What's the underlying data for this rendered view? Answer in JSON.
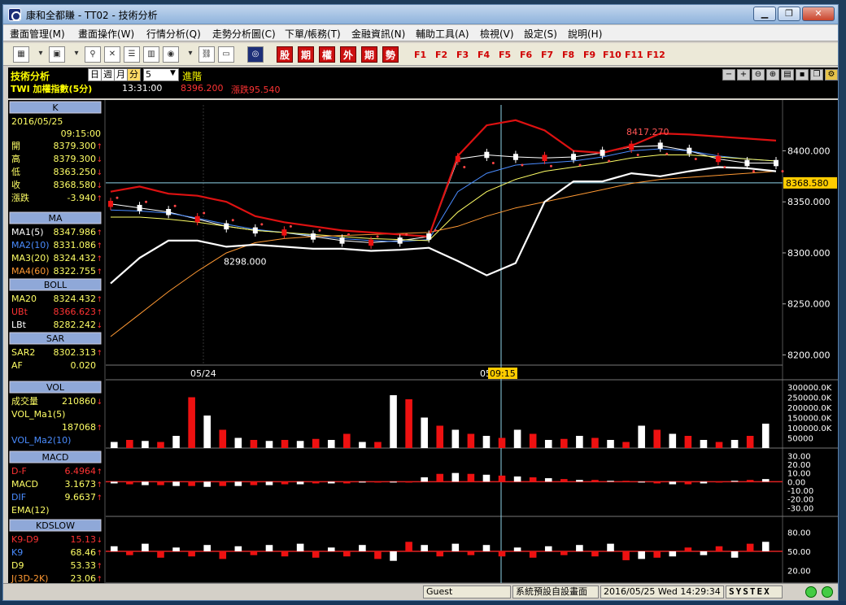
{
  "window": {
    "title": "康和全都賺 - TT02 - 技術分析"
  },
  "menu": [
    "畫面管理(M)",
    "畫面操作(W)",
    "行情分析(Q)",
    "走勢分析圖(C)",
    "下單/帳務(T)",
    "金融資訊(N)",
    "輔助工具(A)",
    "檢視(V)",
    "設定(S)",
    "說明(H)"
  ],
  "toolbar": {
    "red_buttons": [
      "股",
      "期",
      "權",
      "外",
      "期",
      "勢"
    ],
    "fkeys": [
      "F1",
      "F2",
      "F3",
      "F4",
      "F5",
      "F6",
      "F7",
      "F8",
      "F9",
      "F10",
      "F11",
      "F12"
    ]
  },
  "header": {
    "title": "技術分析",
    "period_buttons": [
      "日",
      "週",
      "月",
      "分"
    ],
    "interval": "5",
    "advanced": "進階",
    "symbol": "TWI  加權指數(5分)",
    "time": "13:31:00",
    "price": "8396.200",
    "change": "漲跌95.540"
  },
  "panel": {
    "k": {
      "title": "K",
      "date": "2016/05/25",
      "time": "09:15:00",
      "rows": [
        {
          "label": "開",
          "value": "8379.300",
          "dir": "↑"
        },
        {
          "label": "高",
          "value": "8379.300",
          "dir": "↓"
        },
        {
          "label": "低",
          "value": "8363.250",
          "dir": "↓"
        },
        {
          "label": "收",
          "value": "8368.580",
          "dir": "↓"
        },
        {
          "label": "漲跌",
          "value": "-3.940",
          "dir": "↑"
        }
      ]
    },
    "ma": {
      "title": "MA",
      "rows": [
        {
          "label": "MA1(5)",
          "value": "8347.986",
          "dir": "↑",
          "color": "#ffffff"
        },
        {
          "label": "MA2(10)",
          "value": "8331.086",
          "dir": "↑",
          "color": "#4a8cff"
        },
        {
          "label": "MA3(20)",
          "value": "8324.432",
          "dir": "↑",
          "color": "#ffff66"
        },
        {
          "label": "MA4(60)",
          "value": "8322.755",
          "dir": "↑",
          "color": "#ff9933"
        }
      ]
    },
    "boll": {
      "title": "BOLL",
      "rows": [
        {
          "label": "MA20",
          "value": "8324.432",
          "dir": "↑",
          "color": "#ffff66"
        },
        {
          "label": "UBt",
          "value": "8366.623",
          "dir": "↑",
          "color": "#ff3333"
        },
        {
          "label": "LBt",
          "value": "8282.242",
          "dir": "↓",
          "color": "#ffffff"
        }
      ]
    },
    "sar": {
      "title": "SAR",
      "rows": [
        {
          "label": "SAR2",
          "value": "8302.313",
          "dir": "↑",
          "color": "#ffff66"
        },
        {
          "label": "AF",
          "value": "0.020",
          "dir": "",
          "color": "#ffff66"
        }
      ]
    },
    "vol": {
      "title": "VOL",
      "rows": [
        {
          "label": "成交量",
          "value": "210860",
          "dir": "↓",
          "color": "#ffff66"
        },
        {
          "label": "VOL_Ma1(5)",
          "value": "",
          "dir": "",
          "color": "#ffff66"
        },
        {
          "label": "",
          "value": "187068",
          "dir": "↑",
          "color": "#ffff66"
        },
        {
          "label": "VOL_Ma2(10)",
          "value": "",
          "dir": "",
          "color": "#4a8cff"
        }
      ]
    },
    "macd": {
      "title": "MACD",
      "rows": [
        {
          "label": "D-F",
          "value": "6.4964",
          "dir": "↑",
          "color": "#ff3333"
        },
        {
          "label": "MACD",
          "value": "3.1673",
          "dir": "↑",
          "color": "#ffff66"
        },
        {
          "label": "DIF",
          "value": "9.6637",
          "dir": "↑",
          "color": "#4a8cff"
        },
        {
          "label": "EMA(12)",
          "value": "",
          "dir": "",
          "color": "#ffff66"
        }
      ]
    },
    "kd": {
      "title": "KDSLOW",
      "rows": [
        {
          "label": "K9-D9",
          "value": "15.13",
          "dir": "↓",
          "color": "#ff3333"
        },
        {
          "label": "K9",
          "value": "68.46",
          "dir": "↑",
          "color": "#4a8cff"
        },
        {
          "label": "D9",
          "value": "53.33",
          "dir": "↑",
          "color": "#ffff66"
        },
        {
          "label": "J(3D-2K)",
          "value": "23.06",
          "dir": "↑",
          "color": "#ff9933"
        }
      ]
    }
  },
  "chart_data": [
    {
      "type": "line",
      "name": "price",
      "ylim": [
        8190,
        8445
      ],
      "yticks": [
        8200,
        8250,
        8300,
        8350,
        8400
      ],
      "ytick_labels": [
        "8200.000",
        "8250.000",
        "8300.000",
        "8350.000",
        "8400.000"
      ],
      "current": 8368.58,
      "current_label": "8368.580",
      "annotations": [
        {
          "text": "8417.270",
          "value": 8417.27
        },
        {
          "text": "8298.000",
          "value": 8298.0
        }
      ],
      "x_labels": [
        "05/24",
        "05",
        "09:15"
      ],
      "series": [
        {
          "color": "#ffffff",
          "values": [
            8348,
            8344,
            8340,
            8333,
            8326,
            8322,
            8320,
            8316,
            8312,
            8310,
            8312,
            8316,
            8392,
            8396,
            8394,
            8393,
            8394,
            8398,
            8404,
            8405,
            8400,
            8392,
            8388,
            8388
          ]
        },
        {
          "color": "#4a8cff",
          "values": [
            8342,
            8341,
            8339,
            8334,
            8328,
            8323,
            8320,
            8317,
            8314,
            8312,
            8311,
            8313,
            8360,
            8378,
            8386,
            8388,
            8390,
            8394,
            8400,
            8402,
            8400,
            8395,
            8392,
            8390
          ]
        },
        {
          "color": "#ffff66",
          "values": [
            8335,
            8335,
            8333,
            8330,
            8326,
            8322,
            8320,
            8318,
            8316,
            8314,
            8313,
            8312,
            8340,
            8360,
            8372,
            8380,
            8384,
            8388,
            8393,
            8396,
            8396,
            8394,
            8392,
            8390
          ]
        },
        {
          "color": "#ff9933",
          "values": [
            8218,
            8240,
            8262,
            8282,
            8300,
            8310,
            8314,
            8316,
            8317,
            8318,
            8319,
            8320,
            8326,
            8336,
            8344,
            8350,
            8356,
            8362,
            8368,
            8372,
            8374,
            8376,
            8378,
            8380
          ]
        },
        {
          "color": "#dd1111",
          "values": [
            8360,
            8365,
            8358,
            8356,
            8350,
            8336,
            8330,
            8326,
            8322,
            8320,
            8318,
            8316,
            8395,
            8425,
            8430,
            8420,
            8400,
            8398,
            8405,
            8417,
            8416,
            8414,
            8412,
            8410
          ]
        },
        {
          "color": "#ffffff",
          "values": [
            8270,
            8295,
            8312,
            8312,
            8306,
            8308,
            8306,
            8304,
            8304,
            8302,
            8303,
            8305,
            8292,
            8278,
            8290,
            8350,
            8370,
            8370,
            8378,
            8375,
            8380,
            8384,
            8383,
            8380
          ]
        }
      ]
    },
    {
      "type": "bar",
      "name": "volume",
      "ylim": [
        0,
        320000
      ],
      "yticks": [
        50000,
        100000,
        150000,
        200000,
        250000,
        300000
      ],
      "ytick_labels": [
        "50000",
        "100000.0K",
        "150000.0K",
        "200000.0K",
        "250000.0K",
        "300000.0K"
      ],
      "values": [
        30000,
        40000,
        35000,
        30000,
        60000,
        250000,
        160000,
        90000,
        50000,
        40000,
        35000,
        40000,
        35000,
        45000,
        40000,
        70000,
        30000,
        30000,
        260000,
        240000,
        150000,
        110000,
        90000,
        70000,
        60000,
        50000,
        90000,
        70000,
        40000,
        45000,
        60000,
        50000,
        40000,
        30000,
        110000,
        90000,
        70000,
        60000,
        40000,
        30000,
        40000,
        60000,
        120000
      ]
    },
    {
      "type": "bar",
      "name": "macd",
      "ylim": [
        -40,
        35
      ],
      "yticks": [
        -30,
        -20,
        -10,
        0,
        10,
        20,
        30
      ],
      "ytick_labels": [
        "-30.00",
        "-20.00",
        "-10.00",
        "0.00",
        "10.00",
        "20.00",
        "30.00"
      ],
      "values": [
        -2,
        -3,
        -4,
        -4,
        -5,
        -5,
        -6,
        -5,
        -5,
        -4,
        -4,
        -3,
        -3,
        -2,
        -2,
        -2,
        -1,
        -1,
        -1,
        -1,
        5,
        9,
        10,
        9,
        8,
        7,
        6,
        5,
        4,
        3,
        2,
        2,
        1,
        1,
        -1,
        -2,
        -3,
        -3,
        -2,
        -1,
        1,
        2,
        3
      ]
    },
    {
      "type": "bar",
      "name": "kd",
      "ylim": [
        0,
        100
      ],
      "yticks": [
        20,
        50,
        80
      ],
      "ytick_labels": [
        "20.00",
        "50.00",
        "80.00"
      ],
      "values": [
        8,
        -6,
        12,
        -10,
        6,
        -8,
        10,
        -12,
        8,
        -6,
        10,
        -8,
        12,
        -10,
        6,
        -8,
        10,
        -12,
        -15,
        15,
        10,
        -8,
        12,
        -6,
        10,
        -8,
        6,
        -10,
        8,
        -6,
        10,
        -8,
        12,
        -14,
        -12,
        -10,
        -8,
        6,
        -6,
        8,
        -10,
        12,
        15
      ]
    }
  ],
  "status": {
    "user": "Guest",
    "screen": "系統預設自設畫面",
    "datetime": "2016/05/25 Wed 14:29:34",
    "brand": "SYSTEX"
  }
}
